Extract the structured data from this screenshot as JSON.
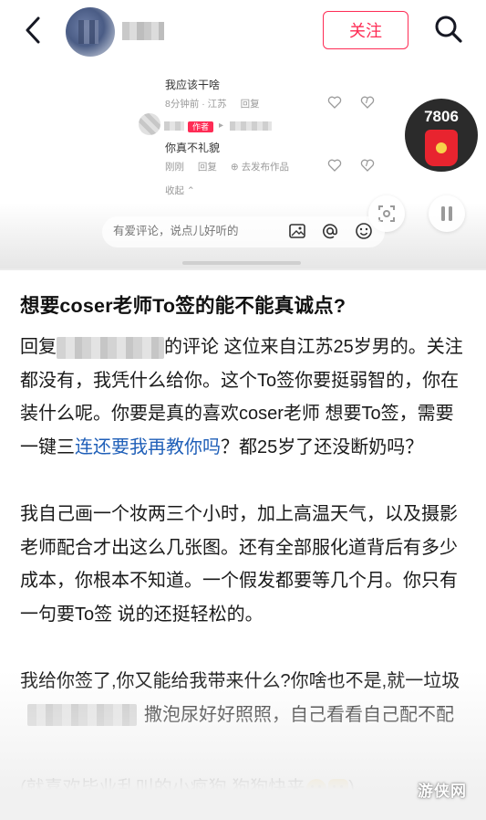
{
  "header": {
    "follow_label": "关注",
    "icons": {
      "back": "chevron-left-icon",
      "search": "search-icon"
    }
  },
  "comments": {
    "comment1": {
      "text": "我应该干啥",
      "time": "8分钟前 · 江苏",
      "reply": "回复"
    },
    "comment2": {
      "author_badge": "作者",
      "text": "你真不礼貌",
      "time": "刚刚",
      "reply": "回复",
      "go_publish": "去发布作品"
    },
    "collapse": "收起 ⌃",
    "input_placeholder": "有爱评论，说点儿好听的",
    "bonus_count": "7806"
  },
  "article": {
    "title": "想要coser老师To签的能不能真诚点?",
    "p1_a": "回复",
    "p1_b": "的评论 这位来自江苏25岁男的。关注都没有，我凭什么给你。这个To签你要挺弱智的，你在装什么呢。你要是真的喜欢coser老师  想要To签，需要一键三",
    "p1_link": "连还要我再教你吗",
    "p1_c": "？都25岁了还没断奶吗？",
    "p2": "我自己画一个妆两三个小时，加上高温天气，以及摄影老师配合才出这么几张图。还有全部服化道背后有多少成本，你根本不知道。一个假发都要等几个月。你只有一句要To签 说的还挺轻松的。",
    "p3_a": "我给你签了,你又能给我带来什么?你啥也不是,就一垃圾",
    "p3_b": "撒泡尿好好照照，自己看看自己配不配",
    "p4": "(就喜欢毕业乱叫的小疯狗 狗狗快来",
    "p4_end": ")"
  },
  "watermark": "游侠网",
  "colors": {
    "accent": "#fe2c55",
    "link": "#1f5fb8"
  }
}
